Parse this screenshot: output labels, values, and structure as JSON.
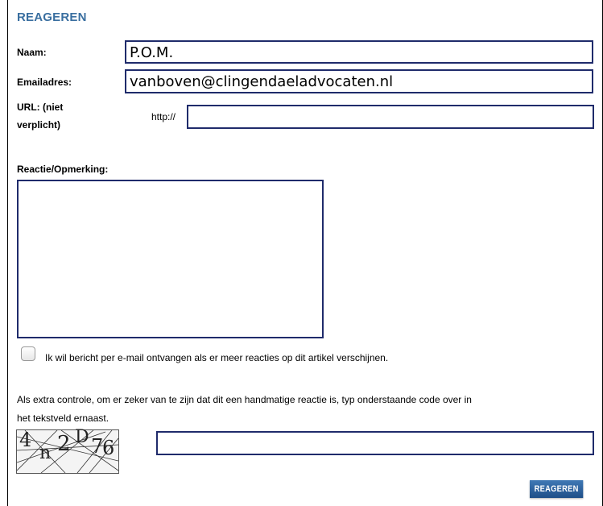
{
  "form": {
    "title": "REAGEREN",
    "name_label": "Naam:",
    "name_value": "P.O.M.",
    "email_label": "Emailadres:",
    "email_value": "vanboven@clingendaeladvocaten.nl",
    "url_label_line1": "URL: (niet",
    "url_label_line2": "verplicht)",
    "url_prefix": "http://",
    "url_value": "",
    "comment_label": "Reactie/Opmerking:",
    "comment_value": "",
    "notify_label": "Ik wil bericht per e-mail ontvangen als er meer reacties op dit artikel verschijnen.",
    "notify_checked": false,
    "captcha_instructions_line1": "Als extra controle, om er zeker van te zijn dat dit een handmatige reactie is, typ onderstaande code over in",
    "captcha_instructions_line2": "het tekstveld ernaast.",
    "captcha_code": "4n2D76",
    "captcha_value": "",
    "submit_label": "REAGEREN"
  }
}
